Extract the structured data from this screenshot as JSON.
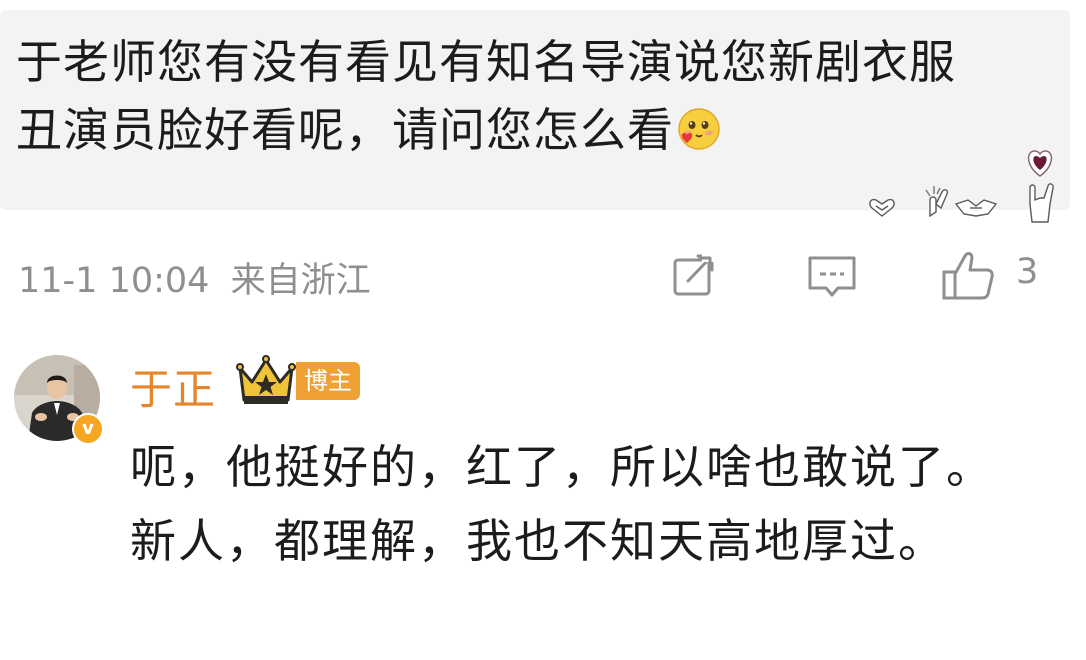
{
  "comment": {
    "text": "于老师您有没有看见有知名导演说您新剧衣服丑演员脸好看呢，请问您怎么看",
    "emoji": "blush-heart-emoji",
    "sticker": "hand-gestures-heart-sticker"
  },
  "meta": {
    "date": "11-1",
    "time": "10:04",
    "location": "来自浙江",
    "like_count": "3"
  },
  "icons": {
    "repost": "repost-icon",
    "comment": "comment-icon",
    "like": "thumbs-up-icon"
  },
  "reply": {
    "author": "于正",
    "badge": "博主",
    "text": "呃，他挺好的，红了，所以啥也敢说了。新人，都理解，我也不知天高地厚过。"
  },
  "colors": {
    "bubble_bg": "#f3f3f3",
    "meta_gray": "#8f8f8f",
    "author_orange": "#e6862b",
    "badge_orange": "#f0a136"
  }
}
